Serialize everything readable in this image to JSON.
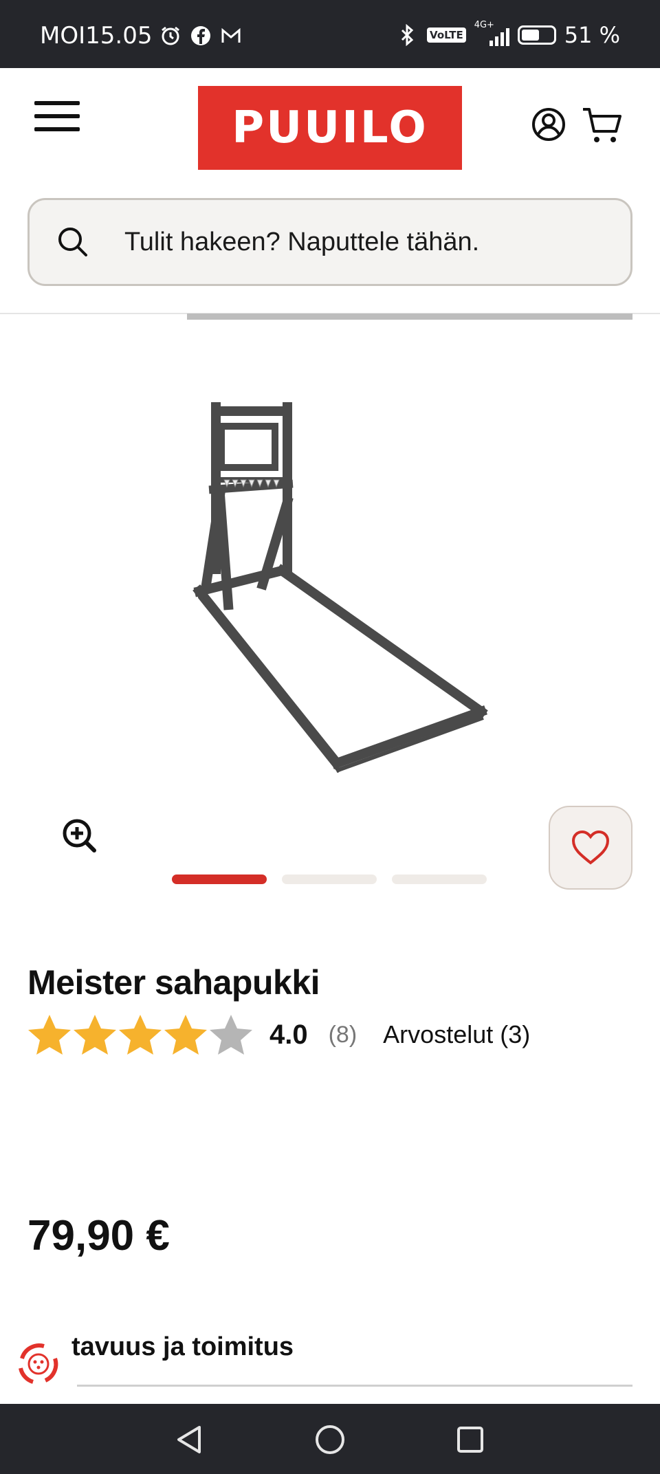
{
  "status_bar": {
    "carrier_time": "MOI15.05",
    "icons": [
      "alarm-icon",
      "facebook-icon",
      "gmail-icon",
      "bluetooth-icon",
      "volte-icon",
      "signal-icon",
      "battery-icon"
    ],
    "volte": "VoLTE",
    "network": "4G+",
    "battery_level": 0.51,
    "battery": "51 %"
  },
  "header": {
    "logo": "PUUILO",
    "brand_color": "#e2322b"
  },
  "search": {
    "placeholder": "Tulit hakeen? Naputtele tähän."
  },
  "gallery": {
    "image_count": 3,
    "active_index": 0
  },
  "product": {
    "title": "Meister sahapukki",
    "rating_value": 4.0,
    "rating_text": "4.0",
    "rating_count": "(8)",
    "reviews_link": "Arvostelut (3)",
    "price": "79,90 €"
  },
  "availability": {
    "label": "tavuus ja toimitus"
  },
  "colors": {
    "star_filled": "#f6b22d",
    "star_empty": "#b5b5b5",
    "accent": "#d42e27",
    "status_bar_bg": "#25262b"
  }
}
